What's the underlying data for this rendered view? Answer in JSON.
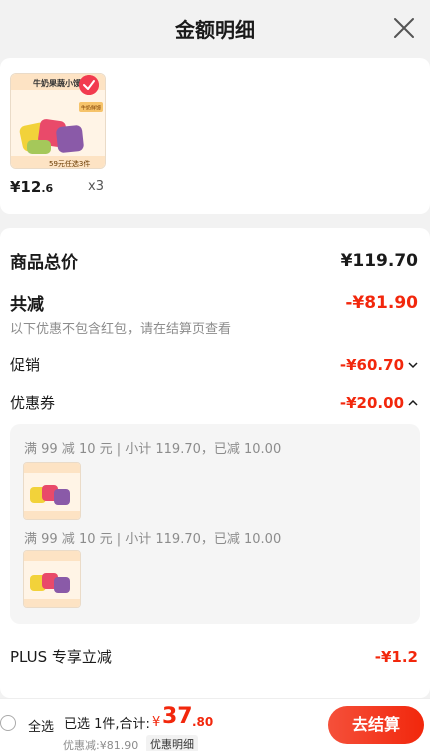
{
  "header": {
    "title": "金额明细",
    "close_icon": "close-icon"
  },
  "product": {
    "name_on_image": "牛奶果蔬小馒头",
    "brand_tag": "牛奶鲜馒",
    "promo_tag": "59元任选3件",
    "price_int": "¥12",
    "price_dec": ".6",
    "qty": "x3",
    "check_icon": "checkmark-icon"
  },
  "detail": {
    "subtotal_label": "商品总价",
    "subtotal_value": "¥119.70",
    "total_off_label": "共减",
    "total_off_value": "-¥81.90",
    "note": "以下优惠不包含红包，请在结算页查看",
    "promo_label": "促销",
    "promo_value": "-¥60.70",
    "coupon_label": "优惠券",
    "coupon_value": "-¥20.00",
    "coupon_lines": [
      "满 99 减 10 元 | 小计 119.70，已减 10.00",
      "满 99 减 10 元 | 小计 119.70，已减 10.00"
    ],
    "plus_label": "PLUS 专享立减",
    "plus_value": "-¥1.2"
  },
  "bottom": {
    "select_all": "全选",
    "selected_info": "已选 1件,合计:",
    "total_symbol": "¥",
    "total_int": "37",
    "total_dec": ".80",
    "discount_text": "优惠减:¥81.90",
    "detail_link": "优惠明细",
    "checkout": "去结算"
  },
  "colors": {
    "accent": "#f2270c",
    "bg": "#f2f2f2"
  }
}
